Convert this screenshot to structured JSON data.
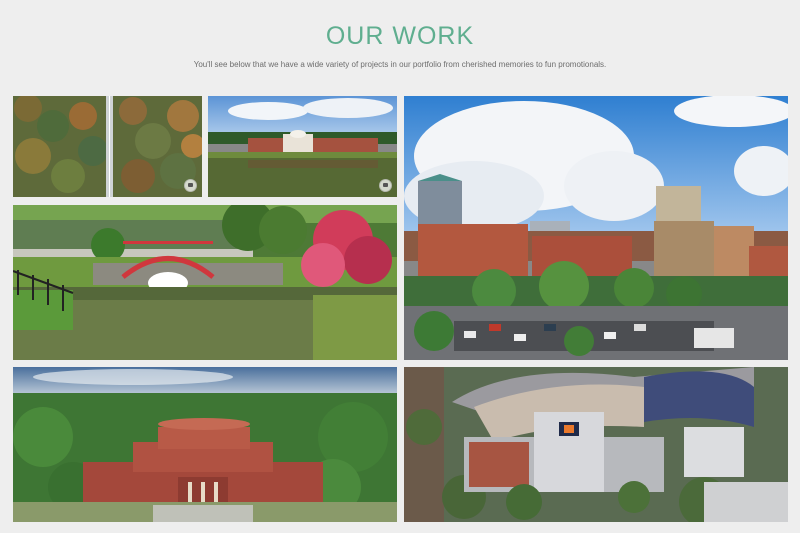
{
  "section": {
    "title": "OUR WORK",
    "subtitle": "You'll see below that we have a wide variety of projects in our portfolio from cherished memories to fun promotionals."
  },
  "gallery": {
    "items": [
      {
        "icon": "forest-road-aerial-image"
      },
      {
        "icon": "museum-pond-image"
      },
      {
        "icon": "city-skyline-image"
      },
      {
        "icon": "red-bridge-garden-image"
      },
      {
        "icon": "rotunda-building-image"
      },
      {
        "icon": "stadium-aerial-image"
      }
    ],
    "overlay_icon": "camera-icon"
  },
  "colors": {
    "background": "#eeeeee",
    "title": "#5fae8f",
    "subtitle": "#6d6d6d"
  }
}
